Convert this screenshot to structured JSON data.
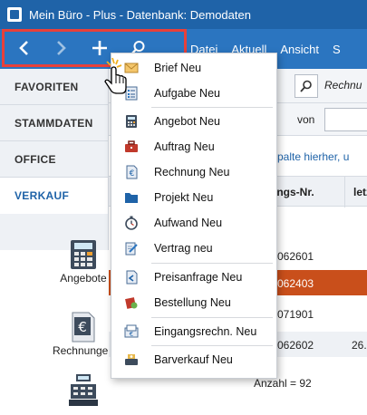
{
  "window": {
    "title": "Mein Büro - Plus - Datenbank: Demodaten"
  },
  "nav": {
    "back_icon": "chevron-left-icon",
    "forward_icon": "chevron-right-icon",
    "new_icon": "plus-icon",
    "search_icon": "search-icon",
    "highlight_color": "#e8403a"
  },
  "menu": {
    "items": [
      "Datei",
      "Aktuell",
      "Ansicht",
      "S"
    ]
  },
  "sidebar": {
    "items": [
      "FAVORITEN",
      "STAMMDATEN",
      "OFFICE",
      "VERKAUF"
    ],
    "tiles": [
      {
        "label": "Angebote",
        "icon": "calculator-icon"
      },
      {
        "label": "Rechnungen",
        "icon": "euro-document-icon"
      },
      {
        "label": "",
        "icon": "cash-register-icon"
      }
    ]
  },
  "main": {
    "search_value": "Rechnu",
    "filter_label": "von",
    "group_hint": "e Spalte hierher, u",
    "columns": [
      "ungs-Nr.",
      "letz"
    ],
    "rows": [
      {
        "nr": "062601",
        "extra": ""
      },
      {
        "nr": "062403",
        "extra": ""
      },
      {
        "nr": "071901",
        "extra": ""
      },
      {
        "nr": "062602",
        "extra": "26."
      }
    ],
    "summary": "Anzahl = 92"
  },
  "dropdown": {
    "items": [
      {
        "label": "Brief Neu",
        "icon": "letter-icon"
      },
      {
        "label": "Aufgabe Neu",
        "icon": "task-list-icon"
      },
      {
        "label": "Angebot Neu",
        "icon": "calculator-icon"
      },
      {
        "label": "Auftrag Neu",
        "icon": "briefcase-icon"
      },
      {
        "label": "Rechnung Neu",
        "icon": "euro-invoice-icon"
      },
      {
        "label": "Projekt Neu",
        "icon": "folder-icon"
      },
      {
        "label": "Aufwand Neu",
        "icon": "stopwatch-icon"
      },
      {
        "label": "Vertrag neu",
        "icon": "contract-pen-icon"
      },
      {
        "label": "Preisanfrage Neu",
        "icon": "price-request-icon"
      },
      {
        "label": "Bestellung Neu",
        "icon": "order-icon"
      },
      {
        "label": "Eingangsrechn. Neu",
        "icon": "incoming-invoice-icon"
      },
      {
        "label": "Barverkauf Neu",
        "icon": "cash-sale-icon"
      }
    ]
  },
  "colors": {
    "titlebar": "#1f63a8",
    "ribbon": "#2b75c0",
    "selected_row": "#c94f1b",
    "accent_text": "#1f63a8"
  }
}
